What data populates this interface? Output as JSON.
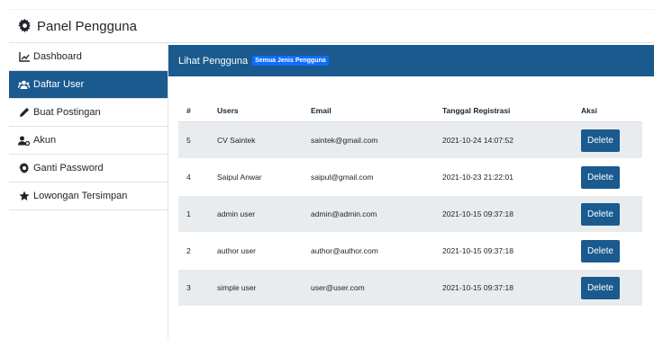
{
  "header": {
    "title": "Panel Pengguna"
  },
  "sidebar": {
    "items": [
      {
        "label": "Dashboard",
        "icon": "chart-line-icon"
      },
      {
        "label": "Daftar User",
        "icon": "users-icon"
      },
      {
        "label": "Buat Postingan",
        "icon": "pencil-icon"
      },
      {
        "label": "Akun",
        "icon": "user-cog-icon"
      },
      {
        "label": "Ganti Password",
        "icon": "cog-icon"
      },
      {
        "label": "Lowongan Tersimpan",
        "icon": "star-icon"
      }
    ],
    "active_index": 1
  },
  "main": {
    "card_title": "Lihat Pengguna",
    "badge": "Semua Jenis Pengguna",
    "table": {
      "headers": [
        "#",
        "Users",
        "Email",
        "Tanggal Registrasi",
        "Aksi"
      ],
      "rows": [
        {
          "id": "5",
          "user": "CV Saintek",
          "email": "saintek@gmail.com",
          "date": "2021-10-24 14:07:52",
          "action": "Delete"
        },
        {
          "id": "4",
          "user": "Saipul Anwar",
          "email": "saipul@gmail.com",
          "date": "2021-10-23 21:22:01",
          "action": "Delete"
        },
        {
          "id": "1",
          "user": "admin user",
          "email": "admin@admin.com",
          "date": "2021-10-15 09:37:18",
          "action": "Delete"
        },
        {
          "id": "2",
          "user": "author user",
          "email": "author@author.com",
          "date": "2021-10-15 09:37:18",
          "action": "Delete"
        },
        {
          "id": "3",
          "user": "simple user",
          "email": "user@user.com",
          "date": "2021-10-15 09:37:18",
          "action": "Delete"
        }
      ]
    }
  },
  "colors": {
    "primary": "#1a5a8e",
    "badge": "#0d6efd",
    "row_alt": "#e9ecef"
  }
}
